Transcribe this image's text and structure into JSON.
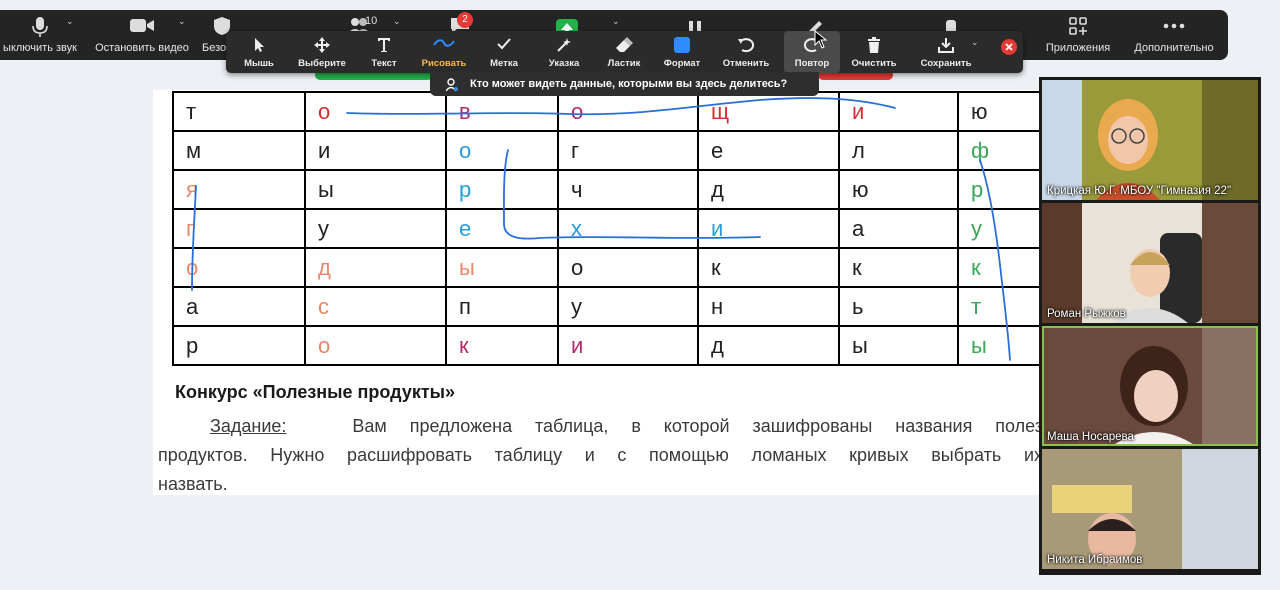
{
  "meeting_toolbar": {
    "items": [
      {
        "label": "ыключить звук",
        "icon": "microphone-icon"
      },
      {
        "label": "Остановить видео",
        "icon": "video-camera-icon"
      },
      {
        "label": "Безо",
        "icon": "security-shield-icon"
      },
      {
        "count": "10",
        "icon": "participants-icon"
      },
      {
        "badge": "2",
        "icon": "chat-icon"
      },
      {
        "icon": "share-screen-icon"
      },
      {
        "icon": "pause-share-icon"
      },
      {
        "icon": "annotate-icon"
      },
      {
        "icon": "more-options-icon"
      },
      {
        "label": "Приложения",
        "icon": "apps-icon"
      },
      {
        "label": "Дополнительно",
        "icon": "more-icon"
      }
    ]
  },
  "annotation_toolbar": {
    "tools": [
      {
        "label": "Мышь",
        "icon": "mouse-pointer-icon"
      },
      {
        "label": "Выберите",
        "icon": "select-move-icon"
      },
      {
        "label": "Текст",
        "icon": "text-icon"
      },
      {
        "label": "Рисовать",
        "icon": "draw-icon",
        "active": true
      },
      {
        "label": "Метка",
        "icon": "stamp-check-icon"
      },
      {
        "label": "Указка",
        "icon": "spotlight-icon"
      },
      {
        "label": "Ластик",
        "icon": "eraser-icon"
      },
      {
        "label": "Формат",
        "icon": "format-color-icon"
      },
      {
        "label": "Отменить",
        "icon": "undo-icon"
      },
      {
        "label": "Повтор",
        "icon": "redo-icon"
      },
      {
        "label": "Очистить",
        "icon": "trash-icon"
      },
      {
        "label": "Сохранить",
        "icon": "save-download-icon"
      }
    ],
    "format_color": "#2d8cff",
    "active_label_color": "#ffb648"
  },
  "share_banner": {
    "text": "Кто может видеть данные, которыми вы здесь делитесь?"
  },
  "document": {
    "grid": [
      [
        {
          "t": "т",
          "c": "#222222"
        },
        {
          "t": "о",
          "c": "#d32f2f"
        },
        {
          "t": "в",
          "c": "#b02a6e"
        },
        {
          "t": "о",
          "c": "#b02a6e"
        },
        {
          "t": "щ",
          "c": "#d32f2f"
        },
        {
          "t": "и",
          "c": "#d32f2f"
        },
        {
          "t": "ю",
          "c": "#222222"
        }
      ],
      [
        {
          "t": "м",
          "c": "#222222"
        },
        {
          "t": "и",
          "c": "#222222"
        },
        {
          "t": "о",
          "c": "#2a9dd8"
        },
        {
          "t": "г",
          "c": "#222222"
        },
        {
          "t": "е",
          "c": "#222222"
        },
        {
          "t": "л",
          "c": "#222222"
        },
        {
          "t": "ф",
          "c": "#3aa65a"
        }
      ],
      [
        {
          "t": "я",
          "c": "#e8886a"
        },
        {
          "t": "ы",
          "c": "#222222"
        },
        {
          "t": "р",
          "c": "#2a9dd8"
        },
        {
          "t": "ч",
          "c": "#222222"
        },
        {
          "t": "д",
          "c": "#222222"
        },
        {
          "t": "ю",
          "c": "#222222"
        },
        {
          "t": "р",
          "c": "#3aa65a"
        }
      ],
      [
        {
          "t": "г",
          "c": "#e8886a"
        },
        {
          "t": "у",
          "c": "#222222"
        },
        {
          "t": "е",
          "c": "#2a9dd8"
        },
        {
          "t": "х",
          "c": "#2a9dd8"
        },
        {
          "t": "и",
          "c": "#2a9dd8"
        },
        {
          "t": "а",
          "c": "#222222"
        },
        {
          "t": "у",
          "c": "#3aa65a"
        }
      ],
      [
        {
          "t": "о",
          "c": "#e8886a"
        },
        {
          "t": "д",
          "c": "#e8886a"
        },
        {
          "t": "ы",
          "c": "#e8886a"
        },
        {
          "t": "о",
          "c": "#222222"
        },
        {
          "t": "к",
          "c": "#222222"
        },
        {
          "t": "к",
          "c": "#222222"
        },
        {
          "t": "к",
          "c": "#3aa65a"
        }
      ],
      [
        {
          "t": "а",
          "c": "#222222"
        },
        {
          "t": "с",
          "c": "#e8886a"
        },
        {
          "t": "п",
          "c": "#222222"
        },
        {
          "t": "у",
          "c": "#222222"
        },
        {
          "t": "н",
          "c": "#222222"
        },
        {
          "t": "ь",
          "c": "#222222"
        },
        {
          "t": "т",
          "c": "#3aa65a"
        }
      ],
      [
        {
          "t": "р",
          "c": "#222222"
        },
        {
          "t": "о",
          "c": "#e8886a"
        },
        {
          "t": "к",
          "c": "#b02a6e"
        },
        {
          "t": "и",
          "c": "#b02a6e"
        },
        {
          "t": "д",
          "c": "#222222"
        },
        {
          "t": "ы",
          "c": "#222222"
        },
        {
          "t": "ы",
          "c": "#3aa65a"
        }
      ]
    ],
    "contest_title": "Конкурс «Полезные продукты»",
    "task_label": "Задание:",
    "task_line1": "Вам предложена таблица, в которой зашифрованы названия полез",
    "task_line2": "продуктов. Нужно расшифровать таблицу и с помощью ломаных кривых выбрать их",
    "task_line3": "назвать.",
    "ink_color": "#2a6fd6"
  },
  "participants": [
    {
      "name": "Крицкая Ю.Г. МБОУ \"Гимназия 22\"",
      "active": false
    },
    {
      "name": "Роман Рыжков",
      "active": false
    },
    {
      "name": "Маша Носарева",
      "active": true
    },
    {
      "name": "Никита Ибраимов",
      "active": false
    }
  ],
  "colors": {
    "toolbar_bg": "#242424",
    "annotation_bg": "#2b2b2b",
    "active_speaker": "#8bc34a",
    "leave_red": "#e53935",
    "chat_badge": "#e53935",
    "share_green": "#22b24c"
  }
}
